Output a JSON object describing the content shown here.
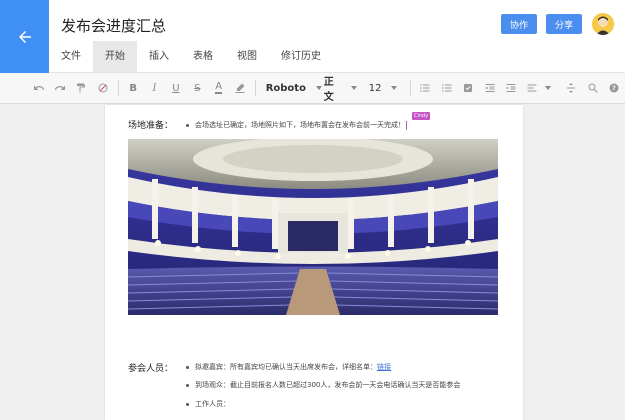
{
  "header": {
    "title": "发布会进度汇总",
    "back_icon": "arrow-left-icon",
    "collaborate_label": "协作",
    "share_label": "分享",
    "accent": "#3f8ff5"
  },
  "menu": {
    "items": [
      {
        "label": "文件"
      },
      {
        "label": "开始",
        "active": true
      },
      {
        "label": "插入"
      },
      {
        "label": "表格"
      },
      {
        "label": "视图"
      },
      {
        "label": "修订历史"
      }
    ]
  },
  "toolbar": {
    "font_family": "Roboto",
    "paragraph_style": "正文",
    "font_size": "12",
    "icons": [
      "undo-icon",
      "redo-icon",
      "format-painter-icon",
      "clear-format-icon",
      "bold-icon",
      "italic-icon",
      "underline-icon",
      "strikethrough-icon",
      "font-color-icon",
      "highlight-icon",
      "unordered-list-icon",
      "ordered-list-icon",
      "checklist-icon",
      "outdent-icon",
      "indent-icon",
      "align-icon",
      "line-spacing-icon",
      "search-icon",
      "help-icon"
    ]
  },
  "document": {
    "venue": {
      "label": "场地准备：",
      "bullet": "会场选址已确定，场地照片如下，场地布置会在发布会前一天完成！",
      "user_tag": "Cindy"
    },
    "attendees": {
      "label": "参会人员：",
      "bullets": [
        {
          "text": "拟邀嘉宾：所有嘉宾均已确认当天出席发布会，详细名单：",
          "link": "链接"
        },
        {
          "text": "到场观众：截止目前报名人数已超过300人，发布会前一天会电话确认当天是否能参会"
        },
        {
          "text": "工作人员："
        }
      ]
    }
  }
}
